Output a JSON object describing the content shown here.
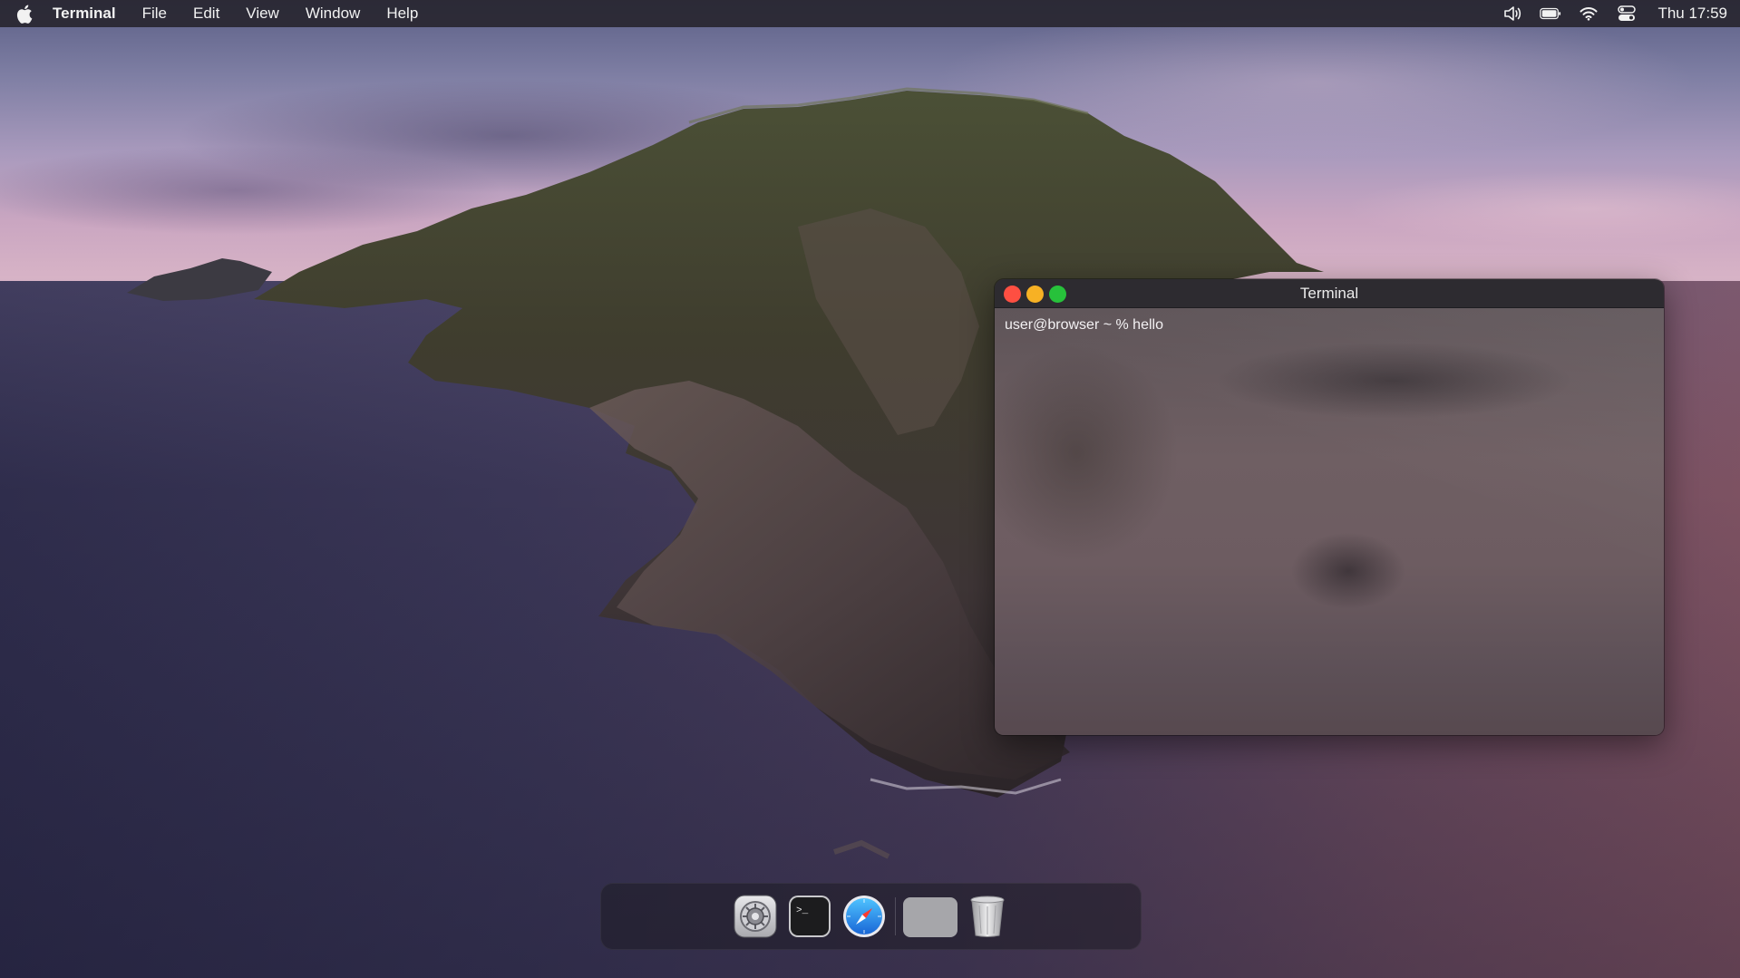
{
  "menubar": {
    "app_name": "Terminal",
    "items": [
      "File",
      "Edit",
      "View",
      "Window",
      "Help"
    ],
    "clock": "Thu 17:59"
  },
  "terminal": {
    "title": "Terminal",
    "prompt_line": "user@browser ~ % hello"
  },
  "dock": {
    "items": [
      "settings-icon",
      "terminal-icon",
      "safari-icon",
      "blank-app-icon",
      "trash-icon"
    ]
  },
  "colors": {
    "close": "#fe4f42",
    "minimize": "#f7b124",
    "maximize": "#27c13b"
  }
}
